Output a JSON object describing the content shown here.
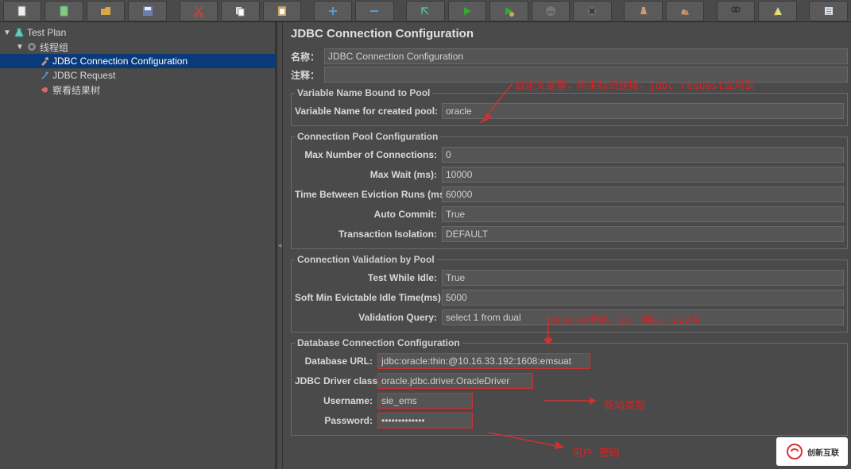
{
  "toolbar": {
    "buttons": [
      "new",
      "templates",
      "open",
      "save",
      "cut",
      "copy",
      "paste",
      "add",
      "remove",
      "debug",
      "run",
      "run-remote",
      "stop",
      "shutdown",
      "clear",
      "clear-all",
      "find",
      "function",
      "options"
    ]
  },
  "tree": {
    "root": {
      "label": "Test Plan"
    },
    "thread_group": {
      "label": "线程组"
    },
    "jdbc_conn": {
      "label": "JDBC Connection Configuration"
    },
    "jdbc_req": {
      "label": "JDBC Request"
    },
    "result_tree": {
      "label": "察看结果树"
    }
  },
  "content": {
    "title": "JDBC Connection Configuration",
    "name_label": "名称：",
    "name_value": "JDBC Connection Configuration",
    "comment_label": "注释：",
    "comment_value": ""
  },
  "pool_binding": {
    "legend": "Variable Name Bound to Pool",
    "var_name_label": "Variable Name for created pool:",
    "var_name_value": "oracle"
  },
  "pool_config": {
    "legend": "Connection Pool Configuration",
    "max_conn_label": "Max Number of Connections:",
    "max_conn_value": "0",
    "max_wait_label": "Max Wait (ms):",
    "max_wait_value": "10000",
    "evict_label": "Time Between Eviction Runs (ms):",
    "evict_value": "60000",
    "auto_commit_label": "Auto Commit:",
    "auto_commit_value": "True",
    "isolation_label": "Transaction Isolation:",
    "isolation_value": "DEFAULT"
  },
  "validation": {
    "legend": "Connection Validation by Pool",
    "test_idle_label": "Test While Idle:",
    "test_idle_value": "True",
    "soft_evict_label": "Soft Min Evictable Idle Time(ms):",
    "soft_evict_value": "5000",
    "query_label": "Validation Query:",
    "query_value": "select 1 from dual"
  },
  "db": {
    "legend": "Database Connection Configuration",
    "url_label": "Database URL:",
    "url_value": "jdbc:oracle:thin:@10.16.33.192:1608:emsuat",
    "driver_label": "JDBC Driver class:",
    "driver_value": "oracle.jdbc.driver.OracleDriver",
    "user_label": "Username:",
    "user_value": "sie_ems",
    "pass_label": "Password:",
    "pass_value": "•••••••••••••"
  },
  "annotations": {
    "a1": "自定义变量，用来标识连接，jdbc request会用到",
    "a2": "oracle地址，ip、端口、sid名",
    "a3": "驱动类型",
    "a4": "用户 密码"
  },
  "watermark": {
    "text": "创新互联"
  }
}
